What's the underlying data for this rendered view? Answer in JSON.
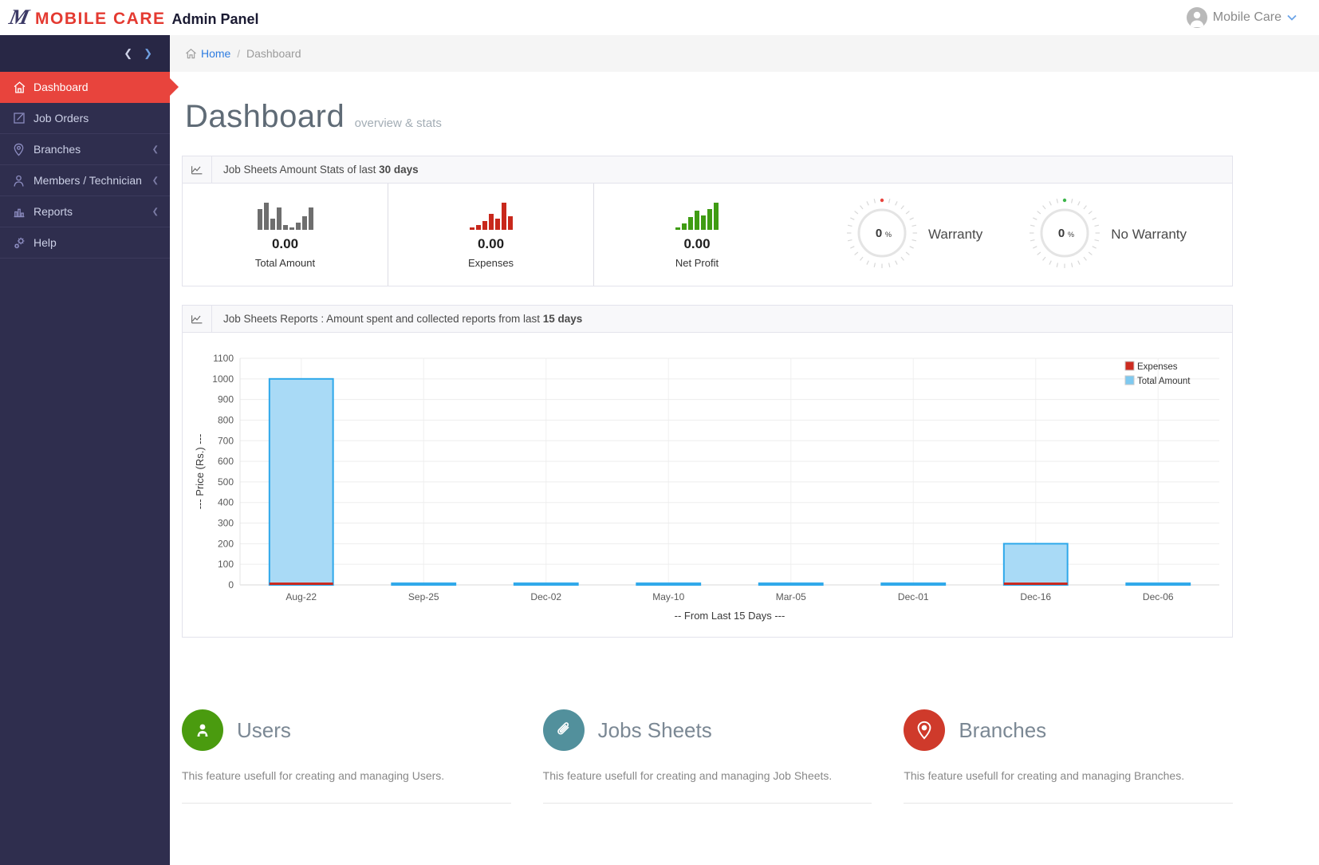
{
  "header": {
    "brand_m": "M",
    "brand_red": "MOBILE CARE",
    "brand_suffix": "Admin Panel",
    "user_name": "Mobile Care"
  },
  "sidebar": {
    "collapse_left": "❮",
    "collapse_right": "❯",
    "items": [
      {
        "label": "Dashboard",
        "icon": "home",
        "active": true
      },
      {
        "label": "Job Orders",
        "icon": "edit-square"
      },
      {
        "label": "Branches",
        "icon": "map-pin",
        "chevron": "❮"
      },
      {
        "label": "Members / Technician",
        "icon": "user",
        "chevron": "❮"
      },
      {
        "label": "Reports",
        "icon": "bar-chart",
        "chevron": "❮"
      },
      {
        "label": "Help",
        "icon": "gears"
      }
    ]
  },
  "breadcrumb": {
    "home": "Home",
    "separator": "/",
    "current": "Dashboard"
  },
  "page": {
    "title": "Dashboard",
    "subtitle": "overview & stats"
  },
  "stats_panel": {
    "title_prefix": "Job Sheets Amount Stats of last ",
    "title_bold": "30 days",
    "stats": [
      {
        "value": "0.00",
        "label": "Total Amount",
        "color": "#6e6e6e",
        "spark": [
          9,
          12,
          5,
          10,
          2,
          1,
          3,
          6,
          10
        ]
      },
      {
        "value": "0.00",
        "label": "Expenses",
        "color": "#c8281c",
        "spark": [
          1,
          2,
          4,
          7,
          5,
          12,
          6
        ]
      },
      {
        "value": "0.00",
        "label": "Net Profit",
        "color": "#3f9c13",
        "spark": [
          1,
          3,
          6,
          9,
          7,
          10,
          13
        ]
      }
    ],
    "gauges": [
      {
        "value": "0",
        "unit": "%",
        "label": "Warranty",
        "dot_color": "#e8443d"
      },
      {
        "value": "0",
        "unit": "%",
        "label": "No Warranty",
        "dot_color": "#3cb54a"
      }
    ]
  },
  "report_panel": {
    "title_prefix": "Job Sheets Reports : Amount spent and collected reports from last ",
    "title_bold": "15 days"
  },
  "chart_data": {
    "type": "bar",
    "categories": [
      "Aug-22",
      "Sep-25",
      "Dec-02",
      "May-10",
      "Mar-05",
      "Dec-01",
      "Dec-16",
      "Dec-06"
    ],
    "series": [
      {
        "name": "Expenses",
        "color": "#cc2b20",
        "values": [
          10,
          0,
          0,
          0,
          0,
          0,
          10,
          0
        ]
      },
      {
        "name": "Total Amount",
        "color": "#a9daf6",
        "border": "#2ea8ea",
        "values": [
          1000,
          8,
          8,
          8,
          8,
          8,
          200,
          8
        ]
      }
    ],
    "xlabel": "-- From Last 15 Days ---",
    "ylabel": "--- Price (Rs.) ---",
    "ylim": [
      0,
      1100
    ],
    "ytick_step": 100,
    "grid": true,
    "legend_position": "top-right"
  },
  "features": [
    {
      "title": "Users",
      "color": "#4a9b0f",
      "icon": "user",
      "desc": "This feature usefull for creating and managing Users."
    },
    {
      "title": "Jobs Sheets",
      "color": "#52909c",
      "icon": "paperclip",
      "desc": "This feature usefull for creating and managing Job Sheets."
    },
    {
      "title": "Branches",
      "color": "#cf3a2b",
      "icon": "map-pin",
      "desc": "This feature usefull for creating and managing Branches."
    }
  ]
}
